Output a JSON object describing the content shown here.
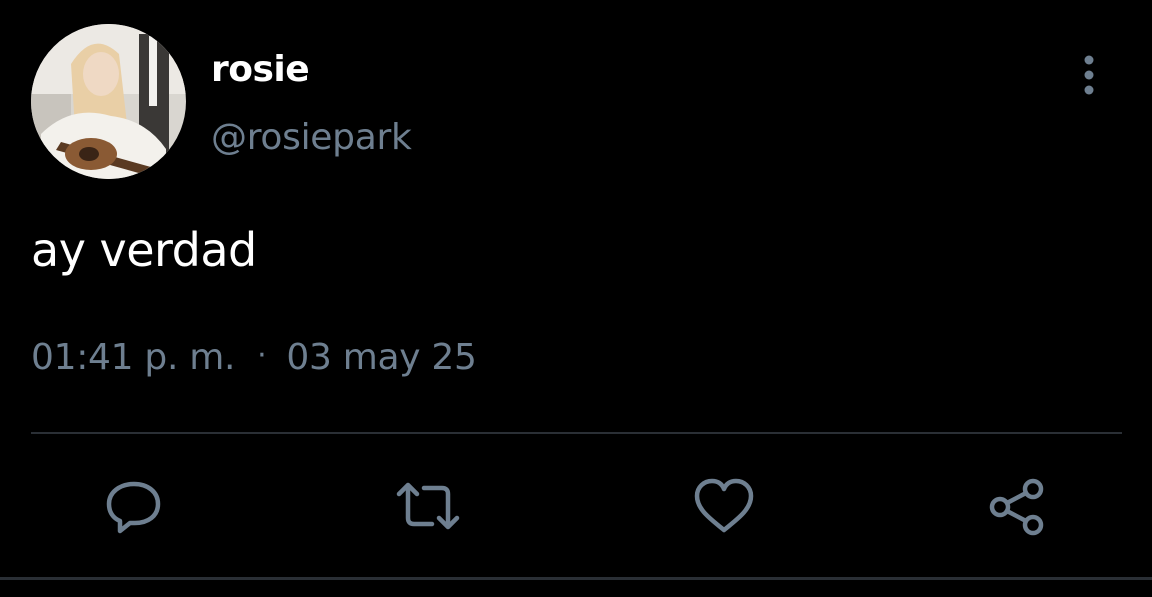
{
  "user": {
    "display_name": "rosie",
    "handle": "@rosiepark"
  },
  "tweet": {
    "text": "ay verdad",
    "time": "01:41 p. m.",
    "separator": "·",
    "date": "03 may 25"
  },
  "actions": {
    "reply_icon": "reply-icon",
    "retweet_icon": "retweet-icon",
    "like_icon": "heart-icon",
    "share_icon": "share-icon",
    "more_icon": "more-vertical-icon"
  },
  "colors": {
    "background": "#000000",
    "primary_text": "#ffffff",
    "secondary_text": "#6e7f90",
    "divider": "#2a2f35"
  }
}
